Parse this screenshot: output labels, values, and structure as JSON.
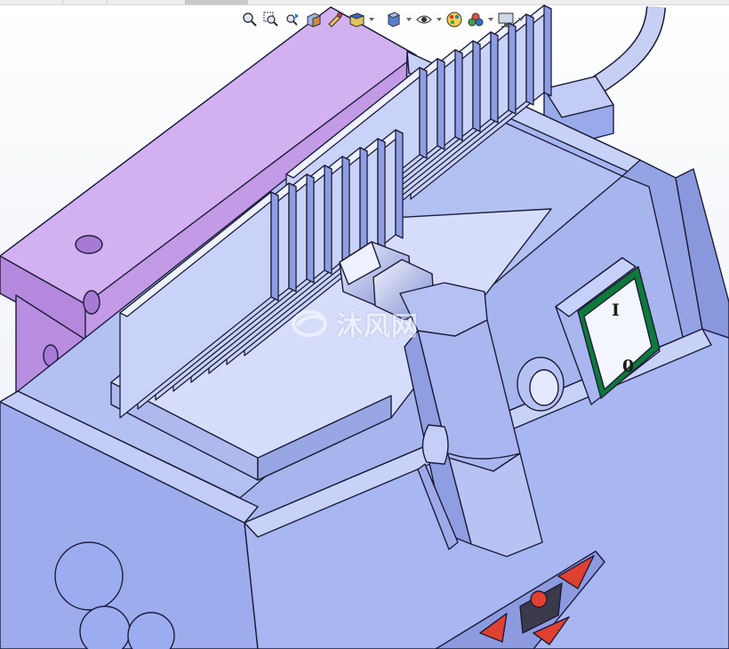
{
  "hud_toolbar": {
    "buttons": [
      {
        "name": "zoom-to-fit-icon",
        "dropdown": false
      },
      {
        "name": "zoom-to-area-icon",
        "dropdown": false
      },
      {
        "name": "previous-view-icon",
        "dropdown": false
      },
      {
        "name": "section-view-icon",
        "dropdown": false
      },
      {
        "name": "dynamic-annotation-icon",
        "dropdown": false
      },
      {
        "name": "view-orientation-icon",
        "dropdown": true
      },
      {
        "name": "display-style-icon",
        "dropdown": true
      },
      {
        "name": "hide-show-items-icon",
        "dropdown": true
      },
      {
        "name": "edit-appearance-icon",
        "dropdown": false
      },
      {
        "name": "apply-scene-icon",
        "dropdown": true
      },
      {
        "name": "view-settings-icon",
        "dropdown": true
      }
    ]
  },
  "rocker_switch": {
    "on_label": "I",
    "off_label": "0",
    "frame_color": "#0e7a3a"
  },
  "watermark": {
    "text": "沐风网"
  },
  "colors": {
    "selected_face": "#c79ae8",
    "body_face": "#a3b1ec",
    "body_dark": "#7f8fd6",
    "edge": "#1c1c3a",
    "control_red": "#e0402f"
  }
}
